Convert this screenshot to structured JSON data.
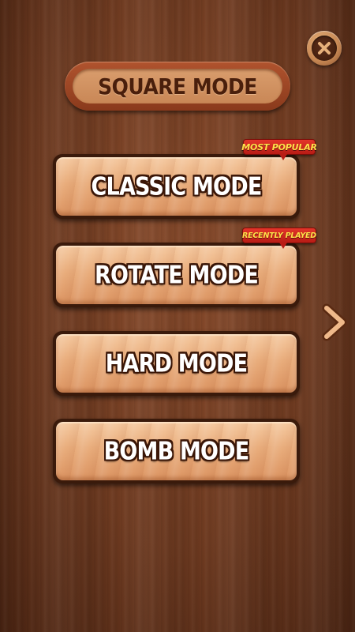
{
  "header": {
    "title": "SQUARE MODE",
    "close_icon": "close-icon"
  },
  "modes": [
    {
      "label": "CLASSIC MODE",
      "badge": "MOST POPULAR"
    },
    {
      "label": "ROTATE MODE",
      "badge": "RECENTLY PLAYED"
    },
    {
      "label": "HARD MODE",
      "badge": ""
    },
    {
      "label": "BOMB MODE",
      "badge": ""
    }
  ],
  "navigation": {
    "next_icon": "chevron-right-icon"
  },
  "colors": {
    "wood_background": "#6e3a20",
    "button_face": "#e9ad7c",
    "badge_red": "#d02a20",
    "badge_text": "#ffe14a",
    "label_outline": "#3a1607"
  }
}
